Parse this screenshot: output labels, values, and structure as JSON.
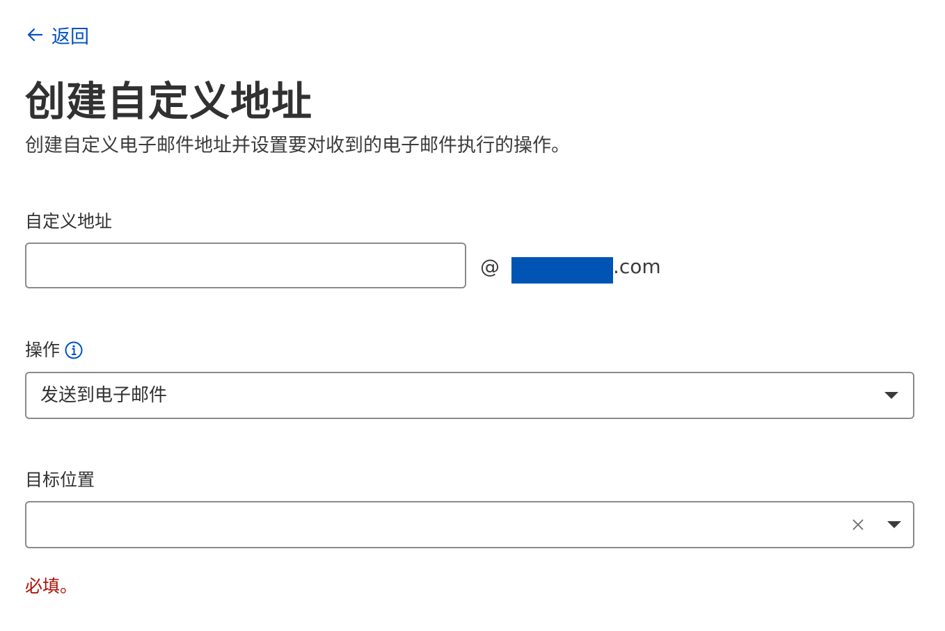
{
  "back": {
    "label": "返回"
  },
  "header": {
    "title": "创建自定义地址",
    "description": "创建自定义电子邮件地址并设置要对收到的电子邮件执行的操作。"
  },
  "custom_address": {
    "label": "自定义地址",
    "value": "",
    "at": "@",
    "domain_suffix": ".com"
  },
  "action": {
    "label": "操作",
    "selected": "发送到电子邮件"
  },
  "destination": {
    "label": "目标位置",
    "selected": "",
    "error": "必填。"
  },
  "colors": {
    "link": "#0051c3",
    "error": "#b20f03",
    "redaction": "#0054b4",
    "border": "#8a8a8a"
  }
}
